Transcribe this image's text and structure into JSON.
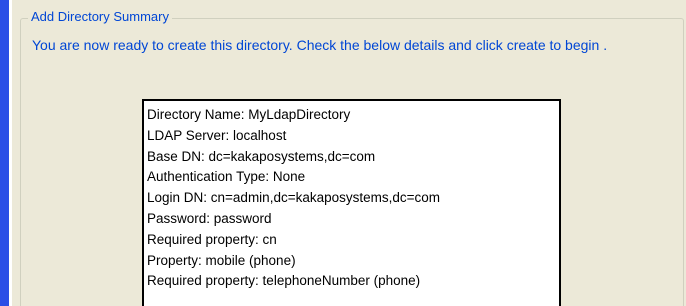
{
  "group": {
    "title": "Add Directory Summary"
  },
  "intro": {
    "text": "You are now ready to create this directory.  Check the below details and click create to begin ."
  },
  "summary": {
    "lines": [
      "Directory Name: MyLdapDirectory",
      "LDAP Server: localhost",
      "Base DN: dc=kakaposystems,dc=com",
      "Authentication Type: None",
      "Login DN: cn=admin,dc=kakaposystems,dc=com",
      "Password: password",
      "Required property: cn",
      "Property: mobile (phone)",
      "Required property: telephoneNumber (phone)"
    ]
  }
}
